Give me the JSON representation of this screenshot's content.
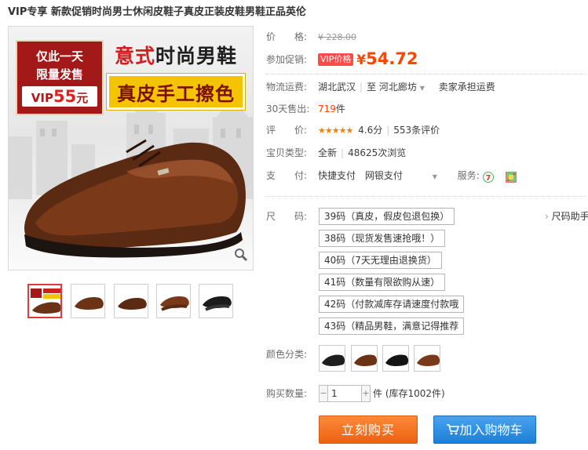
{
  "title": "VIP专享 新款促销时尚男士休闲皮鞋子真皮正装皮鞋男鞋正品英伦",
  "image": {
    "badge_line1": "仅此一天",
    "badge_line2": "限量发售",
    "badge_vip_prefix": "VIP",
    "badge_vip_price": "55",
    "badge_vip_unit": "元",
    "slogan_part1": "意式",
    "slogan_part2": "时尚男鞋",
    "slogan_line2": "真皮手工擦色",
    "zoom_icon": "magnifier-icon"
  },
  "thumbnail_count": 5,
  "price": {
    "label": "价　　格:",
    "original": "¥ 228.00"
  },
  "promo": {
    "label": "参加促销:",
    "tag": "VIP价格",
    "yen": "¥",
    "value": "54.72"
  },
  "shipping": {
    "label": "物流运费:",
    "from": "湖北武汉",
    "sep": "至",
    "to": "河北廊坊",
    "note": "卖家承担运费"
  },
  "sales": {
    "label": "30天售出:",
    "count": "719",
    "unit": "件"
  },
  "rating": {
    "label": "评　　价:",
    "stars": 4.6,
    "stars_glyphs": "★★★★★",
    "score": "4.6分",
    "reviews": "553条评价"
  },
  "item_type": {
    "label": "宝贝类型:",
    "condition": "全新",
    "views": "48625次浏览"
  },
  "payment": {
    "label": "支　　付:",
    "method1": "快捷支付",
    "method2": "网银支付",
    "service_label": "服务:"
  },
  "size": {
    "label": "尺　　码:",
    "help": "尺码助手",
    "options": [
      "39码（真皮，假皮包退包换）",
      "38码（现货发售速抢哦！）",
      "40码（7天无理由退换货）",
      "41码（数量有限欲购从速）",
      "42码（付款减库存请速度付款哦",
      "43码（精品男鞋，满意记得推荐"
    ]
  },
  "color": {
    "label": "颜色分类:",
    "swatch_count": 4
  },
  "quantity": {
    "label": "购买数量:",
    "value": "1",
    "stock": "件 (库存1002件)"
  },
  "buttons": {
    "buy_now": "立刻购买",
    "add_cart": "加入购物车"
  }
}
